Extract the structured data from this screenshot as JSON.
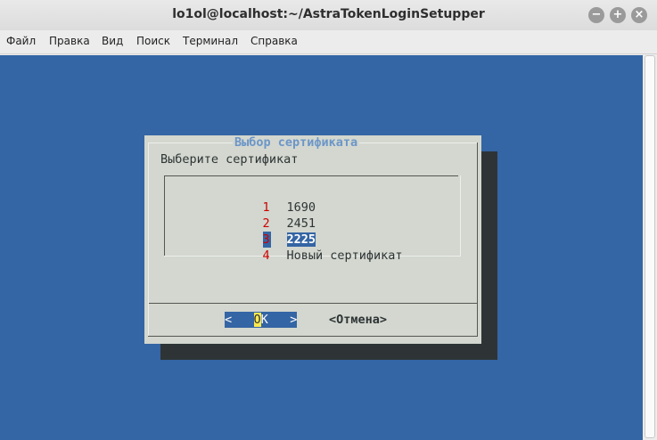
{
  "window": {
    "title": "lo1ol@localhost:~/AstraTokenLoginSetupper",
    "minimize_icon": "−",
    "maximize_icon": "+",
    "close_icon": "×"
  },
  "menu": {
    "items": [
      "Файл",
      "Правка",
      "Вид",
      "Поиск",
      "Терминал",
      "Справка"
    ]
  },
  "dialog": {
    "title": "Выбор сертификата",
    "prompt": "Выберите сертификат",
    "items": [
      {
        "num": "1",
        "label": "1690"
      },
      {
        "num": "2",
        "label": "2451"
      },
      {
        "num": "3",
        "label": "2225"
      },
      {
        "num": "4",
        "label": "Новый сертификат"
      }
    ],
    "selected_index": 2,
    "ok_left": "<",
    "ok_hot": "O",
    "ok_rest": "K",
    "ok_right": ">",
    "cancel_label": "<Отмена>"
  },
  "colors": {
    "terminal_bg": "#3465a4",
    "dialog_bg": "#d3d7cf",
    "title_color": "#6c96c8",
    "number_color": "#cc0000",
    "highlight": "#fce94f"
  }
}
